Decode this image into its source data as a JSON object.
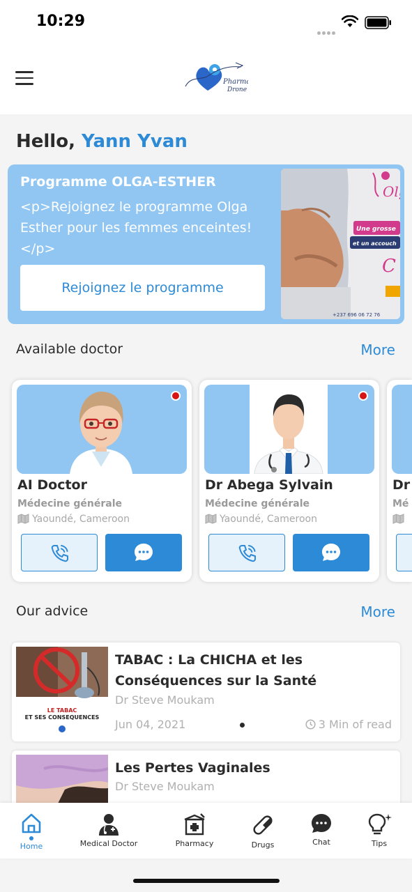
{
  "status": {
    "time": "10:29"
  },
  "header": {
    "logo_name": "Pharma Drone"
  },
  "greeting": {
    "hello": "Hello,",
    "user": "Yann Yvan"
  },
  "banner": {
    "title": "Programme OLGA-ESTHER",
    "text": "<p>Rejoignez le programme Olga Esther pour les femmes enceintes! </p>",
    "button_label": "Rejoignez le programme",
    "image_caption_1": "Une grosse",
    "image_caption_2": "et un accouch",
    "image_phone": "+237 696 06 72 76"
  },
  "doctors_section": {
    "title": "Available doctor",
    "more_label": "More",
    "items": [
      {
        "name": "AI Doctor",
        "specialty": "Médecine générale",
        "location": "Yaoundé, Cameroon"
      },
      {
        "name": "Dr Abega Sylvain",
        "specialty": "Médecine générale",
        "location": "Yaoundé, Cameroon"
      },
      {
        "name": "Dr",
        "specialty": "Mé",
        "location": ""
      }
    ],
    "status_color": "#d81515"
  },
  "advice_section": {
    "title": "Our advice",
    "more_label": "More",
    "items": [
      {
        "title": "TABAC : La CHICHA et les Conséquences sur la Santé",
        "author": "Dr Steve Moukam",
        "date": "Jun 04, 2021",
        "read_time": "3 Min of read",
        "thumb_caption": "LE TABAC ET SES CONSEQUENCES"
      },
      {
        "title": "Les Pertes Vaginales",
        "author": "Dr Steve Moukam"
      }
    ]
  },
  "tabbar": {
    "items": [
      {
        "label": "Home",
        "icon": "home-icon",
        "active": true
      },
      {
        "label": "Medical Doctor",
        "icon": "doctor-icon"
      },
      {
        "label": "Pharmacy",
        "icon": "pharmacy-icon"
      },
      {
        "label": "Drugs",
        "icon": "pill-icon"
      },
      {
        "label": "Chat",
        "icon": "chat-icon"
      },
      {
        "label": "Tips",
        "icon": "lightbulb-icon"
      }
    ]
  },
  "colors": {
    "accent": "#2d8ad6",
    "banner_bg": "#90c6f1",
    "text": "#2b2b2b"
  }
}
